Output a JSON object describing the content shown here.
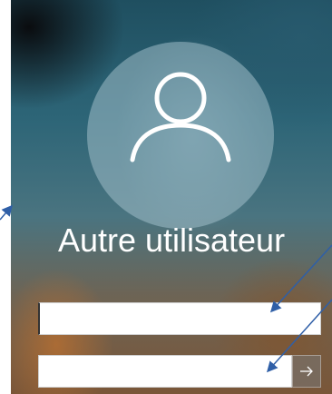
{
  "login": {
    "account_name": "Autre utilisateur",
    "username_value": "",
    "password_value": ""
  },
  "icons": {
    "avatar": "user-icon",
    "submit": "arrow-right-icon"
  },
  "colors": {
    "text": "#ffffff",
    "annotation_arrow": "#2f5fa7"
  }
}
